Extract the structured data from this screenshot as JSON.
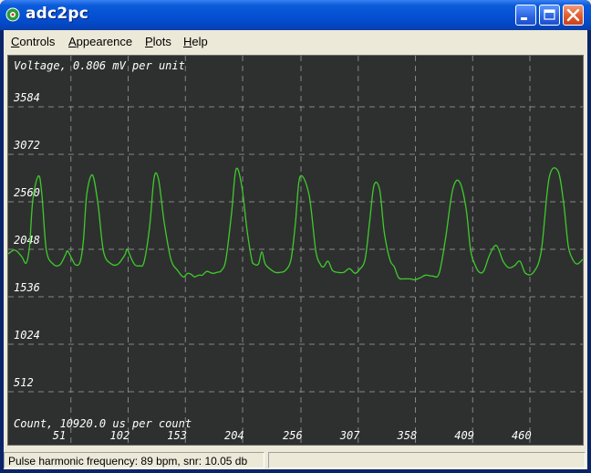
{
  "window": {
    "title": "adc2pc"
  },
  "menu": {
    "items": [
      {
        "label": "Controls",
        "accel": "C",
        "rest": "ontrols"
      },
      {
        "label": "Appearence",
        "accel": "A",
        "rest": "ppearence"
      },
      {
        "label": "Plots",
        "accel": "P",
        "rest": "lots"
      },
      {
        "label": "Help",
        "accel": "H",
        "rest": "elp"
      }
    ]
  },
  "plot": {
    "background": "#2e3030",
    "trace_color": "#3ecb2a",
    "text_color": "#ffffff",
    "grid_color": "#9a9a9a"
  },
  "chart_data": {
    "type": "line",
    "title": "",
    "ylabel": "Voltage, 0.806 mV per unit",
    "xlabel": "Count, 10920.0 us per count",
    "ylim": [
      0,
      4096
    ],
    "xlim": [
      0,
      512
    ],
    "y_ticks": [
      512,
      1024,
      1536,
      2048,
      2560,
      3072,
      3584
    ],
    "x_ticks": [
      51,
      102,
      153,
      204,
      256,
      307,
      358,
      409,
      460
    ],
    "grid": true,
    "series": [
      {
        "x": [
          0,
          6,
          12,
          16,
          19,
          22,
          27,
          30,
          34,
          40,
          46,
          51,
          53,
          57,
          60,
          64,
          67,
          70,
          75,
          80,
          85,
          92,
          98,
          104,
          106,
          110,
          113,
          117,
          121,
          126,
          130,
          134,
          139,
          145,
          151,
          156,
          160,
          164,
          166,
          170,
          173,
          177,
          182,
          186,
          190,
          194,
          199,
          203,
          208,
          213,
          217,
          219,
          223,
          226,
          229,
          234,
          238,
          242,
          247,
          252,
          256,
          260,
          268,
          274,
          278,
          281,
          285,
          289,
          294,
          299,
          304,
          309,
          313,
          318,
          322,
          326,
          331,
          335,
          340,
          344,
          348,
          353,
          358,
          362,
          367,
          372,
          378,
          384,
          390,
          396,
          402,
          408,
          412,
          416,
          420,
          424,
          429,
          435,
          441,
          446,
          451,
          456,
          461,
          468,
          475,
          482,
          490,
          495,
          499,
          503,
          507,
          512
        ],
        "y": [
          1960,
          2000,
          1930,
          1860,
          2040,
          2550,
          2800,
          2600,
          2000,
          1850,
          1840,
          1950,
          1990,
          1900,
          1840,
          1870,
          2100,
          2600,
          2810,
          2500,
          1980,
          1850,
          1850,
          1950,
          2010,
          1900,
          1840,
          1830,
          1870,
          2250,
          2780,
          2760,
          2300,
          1900,
          1780,
          1710,
          1750,
          1730,
          1710,
          1730,
          1730,
          1770,
          1750,
          1760,
          1780,
          1900,
          2400,
          2870,
          2700,
          2200,
          1900,
          1850,
          1850,
          1980,
          1850,
          1790,
          1760,
          1760,
          1780,
          1900,
          2300,
          2790,
          2600,
          2000,
          1850,
          1820,
          1880,
          1780,
          1760,
          1760,
          1800,
          1750,
          1790,
          1900,
          2300,
          2700,
          2650,
          2200,
          1900,
          1820,
          1700,
          1690,
          1690,
          1680,
          1700,
          1730,
          1720,
          1750,
          2150,
          2650,
          2740,
          2450,
          2000,
          1840,
          1760,
          1780,
          1950,
          2050,
          1880,
          1810,
          1830,
          1880,
          1750,
          1760,
          1990,
          2780,
          2850,
          2500,
          2050,
          1900,
          1850,
          1900
        ]
      }
    ]
  },
  "status": {
    "text": "Pulse harmonic frequency: 89 bpm, snr: 10.05 db"
  }
}
